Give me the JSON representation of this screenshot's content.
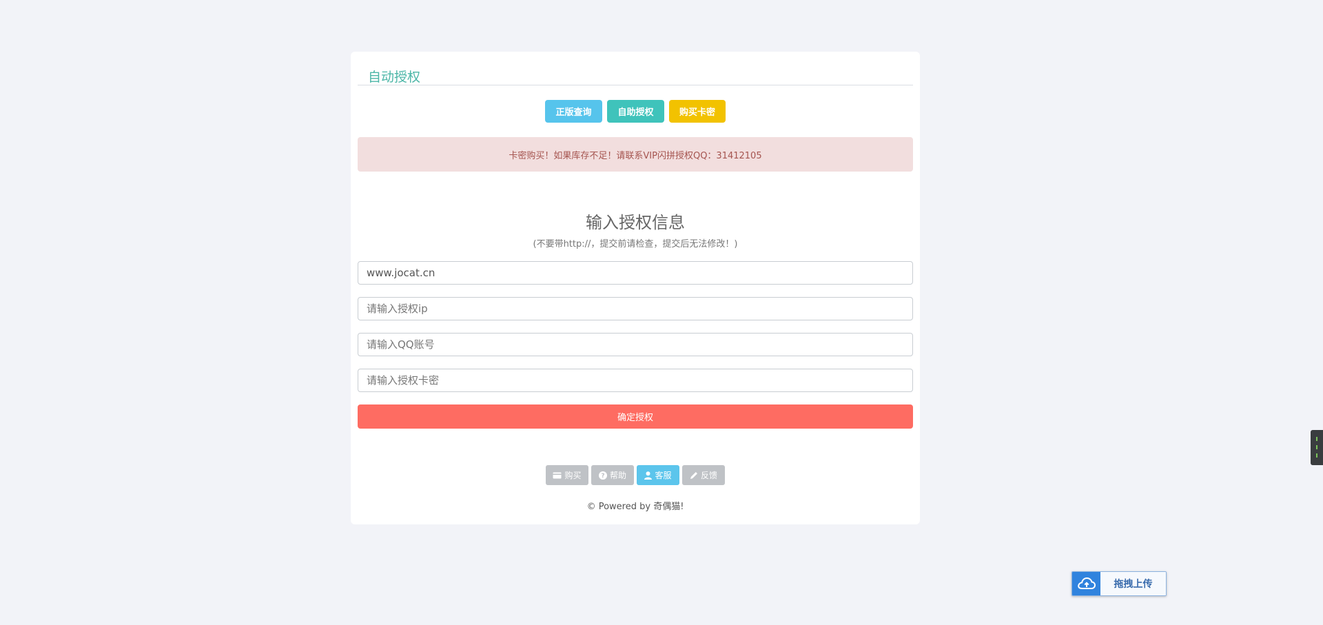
{
  "card": {
    "title": "自动授权",
    "top_buttons": {
      "query": "正版查询",
      "self_auth": "自助授权",
      "buy_card": "购买卡密"
    },
    "alert_text": "卡密购买！如果库存不足！请联系VIP闪拼授权QQ：31412105",
    "form": {
      "heading": "输入授权信息",
      "subheading": "(不要带http://，提交前请检查，提交后无法修改！)",
      "domain_value": "www.jocat.cn",
      "ip_placeholder": "请输入授权ip",
      "qq_placeholder": "请输入QQ账号",
      "card_placeholder": "请输入授权卡密",
      "submit_label": "确定授权"
    },
    "footer_buttons": {
      "buy": "购买",
      "help": "帮助",
      "service": "客服",
      "feedback": "反馈"
    },
    "powered_by": "© Powered by 奇偶猫!"
  },
  "upload_widget": {
    "label": "拖拽上传",
    "icon": "cloud-upload-icon"
  },
  "colors": {
    "background": "#f2f3f8",
    "title": "#4cb6a7",
    "query_button": "#56c4ec",
    "self_auth_button": "#3fc3bb",
    "buy_button": "#f2c200",
    "alert_bg": "#f2dede",
    "alert_text": "#a5544f",
    "submit_button": "#fe6c62",
    "footer_button": "#bfc2c6",
    "footer_button_active": "#5cc5ec",
    "upload_icon_bg": "#3083de"
  },
  "icons": {
    "buy": "credit-card-icon",
    "help": "question-circle-icon",
    "service": "user-icon",
    "feedback": "pencil-icon"
  }
}
